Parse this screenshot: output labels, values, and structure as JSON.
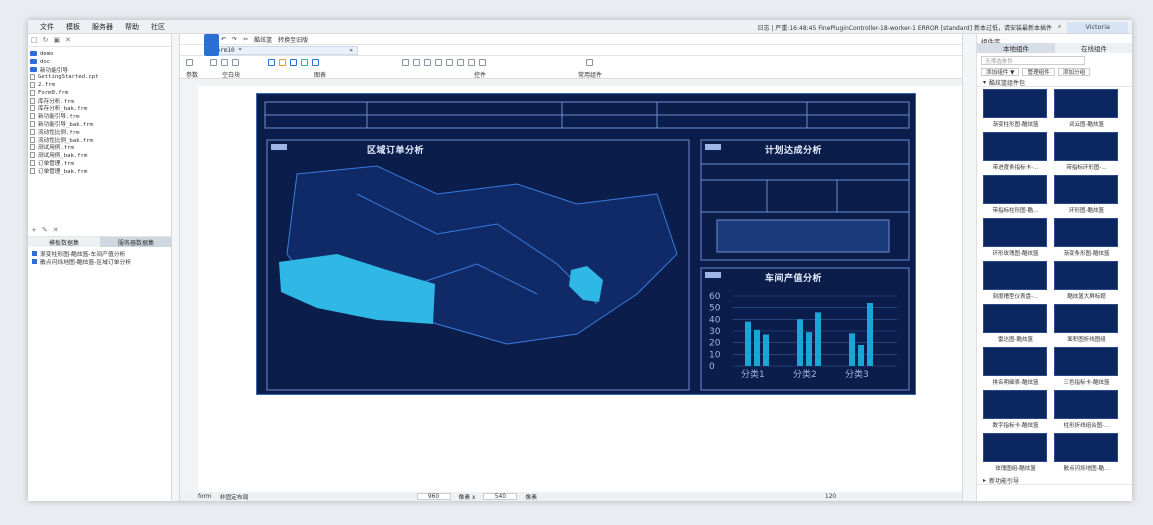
{
  "menu": {
    "items": [
      "文件",
      "模板",
      "服务器",
      "帮助",
      "社区"
    ],
    "status": "日志 | 严重:16:48:45 FinePluginController-18-worker-1 ERROR [standard] 新本过低，请安装最新本插件",
    "user": "Victoria"
  },
  "left": {
    "files": [
      {
        "kind": "folder",
        "name": "demo"
      },
      {
        "kind": "folder",
        "name": "doc"
      },
      {
        "kind": "folder",
        "name": "新功能引导"
      },
      {
        "kind": "file",
        "name": "GettingStarted.cpt"
      },
      {
        "kind": "file",
        "name": "2.frm"
      },
      {
        "kind": "file",
        "name": "Form0.frm"
      },
      {
        "kind": "file",
        "name": "库存分析.frm"
      },
      {
        "kind": "file",
        "name": "库存分析_bak.frm"
      },
      {
        "kind": "file",
        "name": "新功能引导.frm"
      },
      {
        "kind": "file",
        "name": "新功能引导_bak.frm"
      },
      {
        "kind": "file",
        "name": "流动性比例.frm"
      },
      {
        "kind": "file",
        "name": "流动性比例_bak.frm"
      },
      {
        "kind": "file",
        "name": "测试用例.frm"
      },
      {
        "kind": "file",
        "name": "测试用例_bak.frm"
      },
      {
        "kind": "file",
        "name": "订单管理.frm"
      },
      {
        "kind": "file",
        "name": "订单管理_bak.frm"
      }
    ],
    "ds_tabs": [
      "模板数据集",
      "服务器数据集"
    ],
    "datasets": [
      "渐变柱形图-酷炫篮-车间产值分析",
      "散点闪烁地图-酷炫篮-区域订单分析"
    ]
  },
  "editor": {
    "toolbar": {
      "publish": "酷炫篮",
      "switch": "转换至旧版"
    },
    "tab": "Form10 *",
    "ribbon_labels": {
      "params": "参数",
      "blank": "空白块",
      "chart": "图表",
      "widget": "控件",
      "common": "常用组件"
    },
    "status": {
      "form": "form",
      "layout": "非固定布局",
      "w": "960",
      "unit_w": "像素 x",
      "h": "540",
      "unit_h": "像素",
      "zoom": "120"
    }
  },
  "dashboard": {
    "t1": "区域订单分析",
    "t2": "计划达成分析",
    "t3": "车间产值分析",
    "y_ticks": [
      "0",
      "10",
      "20",
      "30",
      "40",
      "50",
      "60"
    ],
    "cats": [
      "分类1",
      "分类2",
      "分类3"
    ]
  },
  "chart_data": {
    "type": "bar",
    "categories": [
      "分类1",
      "分类2",
      "分类3"
    ],
    "series": [
      {
        "values": [
          38,
          40,
          28
        ]
      },
      {
        "values": [
          31,
          29,
          18
        ]
      },
      {
        "values": [
          27,
          46,
          54
        ]
      }
    ],
    "ylim": [
      0,
      60
    ]
  },
  "right": {
    "title": "组件库",
    "tabs": [
      "本地组件",
      "在线组件"
    ],
    "placeholder": "无筛选条件",
    "btns": [
      "添加组件 ▼",
      "管理组件",
      "添加分组"
    ],
    "group": "酷炫篮组件包",
    "footer": "新功能引导",
    "items": [
      "渐变柱形图-酷炫篮",
      "词云图-酷炫篮",
      "带进度条指标卡-...",
      "带指标环形图-...",
      "带指标柱形图-酷...",
      "环形图-酷炫篮",
      "环形玫瑰图-酷炫篮",
      "渐变条形图-酷炫篮",
      "刻度槽型仪表盘-...",
      "酷炫篮大屏标题",
      "雷达图-酷炫篮",
      "面积图折线图组",
      "排名明细表-酷炫篮",
      "三色指标卡-酷炫篮",
      "数字指标卡-酷炫篮",
      "柱形折线组合图-...",
      "玫瑰图组-酷炫篮",
      "散点闪烁地图-酷..."
    ]
  },
  "colors": {
    "accent": "#2b6fd2",
    "dash_bg": "#0b1d4a",
    "bar": "#1aa7d8"
  }
}
